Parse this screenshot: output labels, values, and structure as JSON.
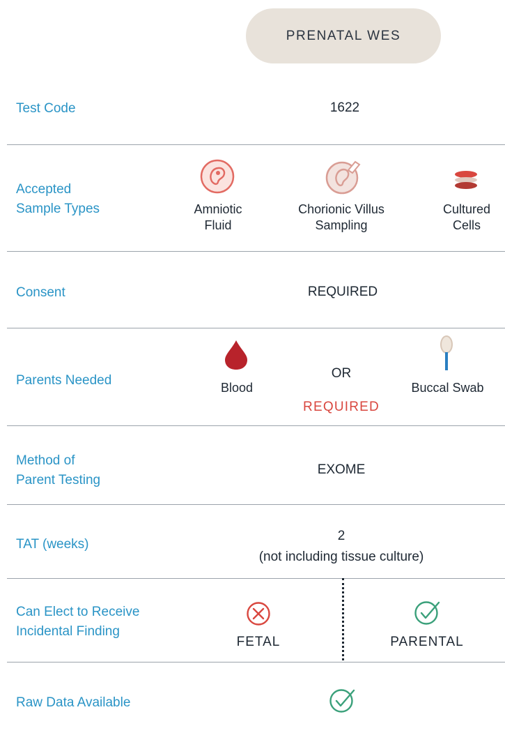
{
  "header": {
    "title": "PRENATAL WES"
  },
  "rows": {
    "test_code": {
      "label": "Test Code",
      "value": "1622"
    },
    "sample_types": {
      "label_line1": "Accepted",
      "label_line2": "Sample Types",
      "items": [
        {
          "line1": "Amniotic",
          "line2": "Fluid",
          "icon": "amniotic-fluid-icon"
        },
        {
          "line1": "Chorionic Villus",
          "line2": "Sampling",
          "icon": "chorionic-villus-icon"
        },
        {
          "line1": "Cultured",
          "line2": "Cells",
          "icon": "cultured-cells-icon"
        }
      ]
    },
    "consent": {
      "label": "Consent",
      "value": "REQUIRED"
    },
    "parents": {
      "label": "Parents Needed",
      "left": "Blood",
      "middle": "OR",
      "right": "Buccal Swab",
      "status": "REQUIRED"
    },
    "method": {
      "label_line1": "Method of",
      "label_line2": "Parent Testing",
      "value": "EXOME"
    },
    "tat": {
      "label": "TAT (weeks)",
      "value": "2",
      "note": "(not including tissue culture)"
    },
    "incidental": {
      "label_line1": "Can Elect to Receive",
      "label_line2": "Incidental Finding",
      "fetal": "FETAL",
      "parental": "PARENTAL"
    },
    "raw_data": {
      "label": "Raw Data Available"
    }
  },
  "colors": {
    "accent": "#2a94c6",
    "required_red": "#d9473f",
    "check_green": "#3aa07a",
    "pill": "#e8e2da"
  }
}
